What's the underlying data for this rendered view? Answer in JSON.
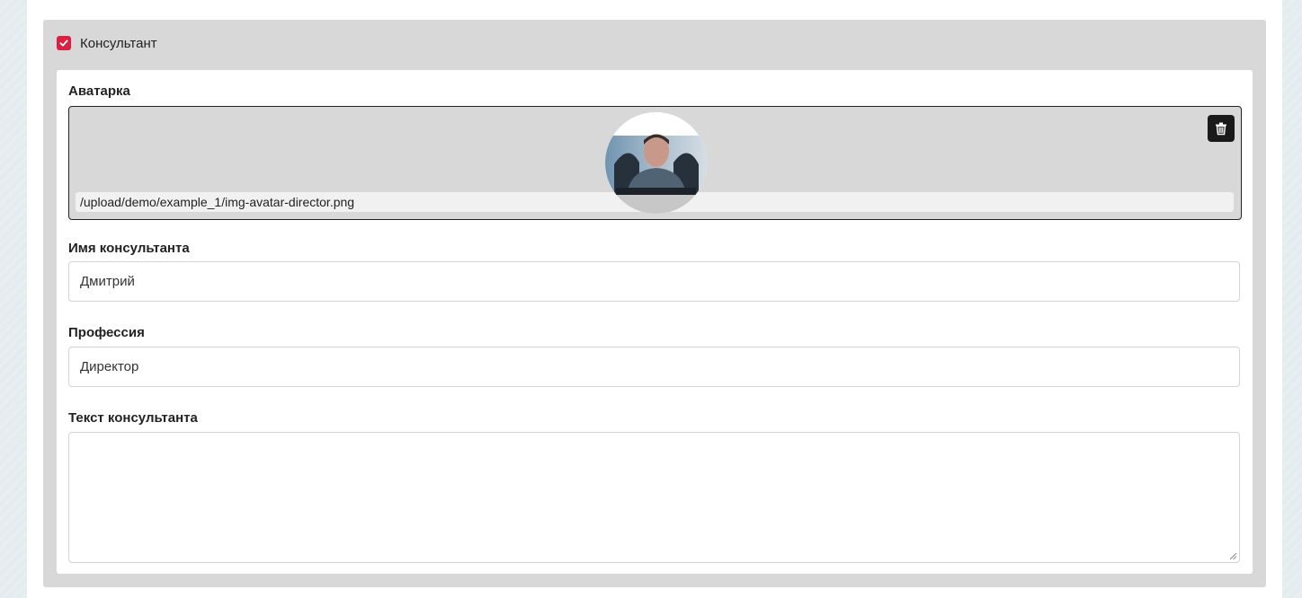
{
  "section": {
    "checkbox_checked": true,
    "title": "Консультант",
    "accent_color": "#dc2043"
  },
  "avatar": {
    "label": "Аватарка",
    "path": "/upload/demo/example_1/img-avatar-director.png",
    "image_icon": "avatar-photo",
    "delete_icon": "trash-icon"
  },
  "name_field": {
    "label": "Имя консультанта",
    "value": "Дмитрий"
  },
  "profession_field": {
    "label": "Профессия",
    "value": "Директор"
  },
  "text_field": {
    "label": "Текст консультанта",
    "value": ""
  }
}
